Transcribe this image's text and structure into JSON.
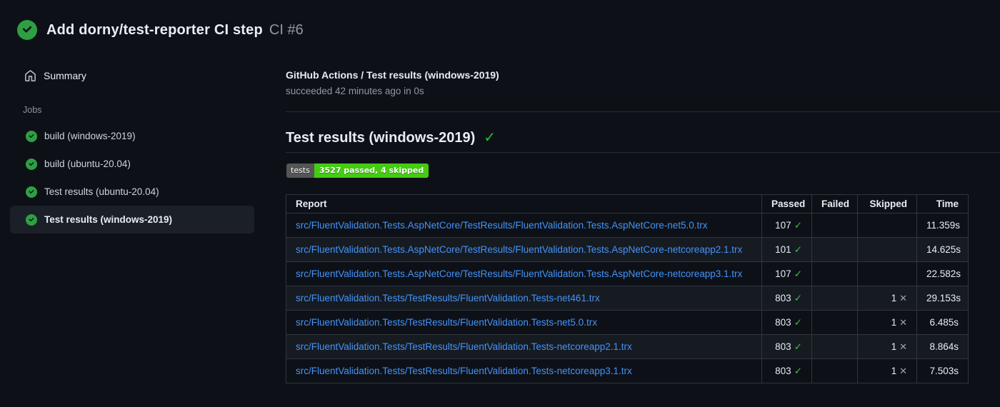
{
  "header": {
    "title": "Add dorny/test-reporter CI step",
    "run_ref": "CI #6"
  },
  "sidebar": {
    "summary_label": "Summary",
    "jobs_label": "Jobs",
    "jobs": [
      {
        "label": "build (windows-2019)",
        "selected": false
      },
      {
        "label": "build (ubuntu-20.04)",
        "selected": false
      },
      {
        "label": "Test results (ubuntu-20.04)",
        "selected": false
      },
      {
        "label": "Test results (windows-2019)",
        "selected": true
      }
    ]
  },
  "main": {
    "check_title": "GitHub Actions / Test results (windows-2019)",
    "check_status": "succeeded 42 minutes ago in 0s",
    "section_heading": "Test results (windows-2019)",
    "badge": {
      "label": "tests",
      "value": "3527 passed, 4 skipped",
      "label_bg": "#555555",
      "value_bg": "#44cc11"
    },
    "table": {
      "columns": [
        "Report",
        "Passed",
        "Failed",
        "Skipped",
        "Time"
      ],
      "rows": [
        {
          "report": "src/FluentValidation.Tests.AspNetCore/TestResults/FluentValidation.Tests.AspNetCore-net5.0.trx",
          "passed": "107",
          "failed": "",
          "skipped": "",
          "time": "11.359s"
        },
        {
          "report": "src/FluentValidation.Tests.AspNetCore/TestResults/FluentValidation.Tests.AspNetCore-netcoreapp2.1.trx",
          "passed": "101",
          "failed": "",
          "skipped": "",
          "time": "14.625s"
        },
        {
          "report": "src/FluentValidation.Tests.AspNetCore/TestResults/FluentValidation.Tests.AspNetCore-netcoreapp3.1.trx",
          "passed": "107",
          "failed": "",
          "skipped": "",
          "time": "22.582s"
        },
        {
          "report": "src/FluentValidation.Tests/TestResults/FluentValidation.Tests-net461.trx",
          "passed": "803",
          "failed": "",
          "skipped": "1",
          "time": "29.153s"
        },
        {
          "report": "src/FluentValidation.Tests/TestResults/FluentValidation.Tests-net5.0.trx",
          "passed": "803",
          "failed": "",
          "skipped": "1",
          "time": "6.485s"
        },
        {
          "report": "src/FluentValidation.Tests/TestResults/FluentValidation.Tests-netcoreapp2.1.trx",
          "passed": "803",
          "failed": "",
          "skipped": "1",
          "time": "8.864s"
        },
        {
          "report": "src/FluentValidation.Tests/TestResults/FluentValidation.Tests-netcoreapp3.1.trx",
          "passed": "803",
          "failed": "",
          "skipped": "1",
          "time": "7.503s"
        }
      ]
    }
  },
  "glyphs": {
    "passed_check": "✓",
    "skipped_cross": "✕",
    "heading_check": "✓"
  },
  "colors": {
    "background": "#0d1117",
    "row_alt": "#161b22",
    "table_border": "#30363d",
    "link_blue": "#4493f8",
    "success_circle": "#2ea043",
    "check_green": "#3fb950",
    "muted_text": "#8b949e",
    "selected_item_bg": "#1b2028",
    "badge_gray": "#555555",
    "badge_green": "#44cc11"
  }
}
